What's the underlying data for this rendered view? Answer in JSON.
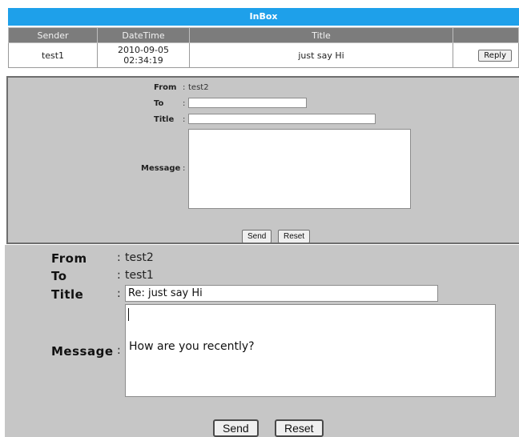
{
  "inbox": {
    "title": "InBox",
    "columns": [
      "Sender",
      "DateTime",
      "Title",
      ""
    ],
    "rows": [
      {
        "sender": "test1",
        "datetime": "2010-09-05 02:34:19",
        "title": "just say Hi",
        "action": "Reply"
      }
    ]
  },
  "compose_small": {
    "from_label": "From",
    "from_value": "test2",
    "to_label": "To",
    "to_value": "",
    "title_label": "Title",
    "title_value": "",
    "message_label": "Message",
    "message_value": "",
    "send_label": "Send",
    "reset_label": "Reset",
    "colon": ":"
  },
  "compose_large": {
    "from_label": "From",
    "from_value": "test2",
    "to_label": "To",
    "to_value": "test1",
    "title_label": "Title",
    "title_value": "Re: just say Hi",
    "message_label": "Message",
    "message_value": "How are you recently?",
    "send_label": "Send",
    "reset_label": "Reset",
    "colon": ":"
  }
}
